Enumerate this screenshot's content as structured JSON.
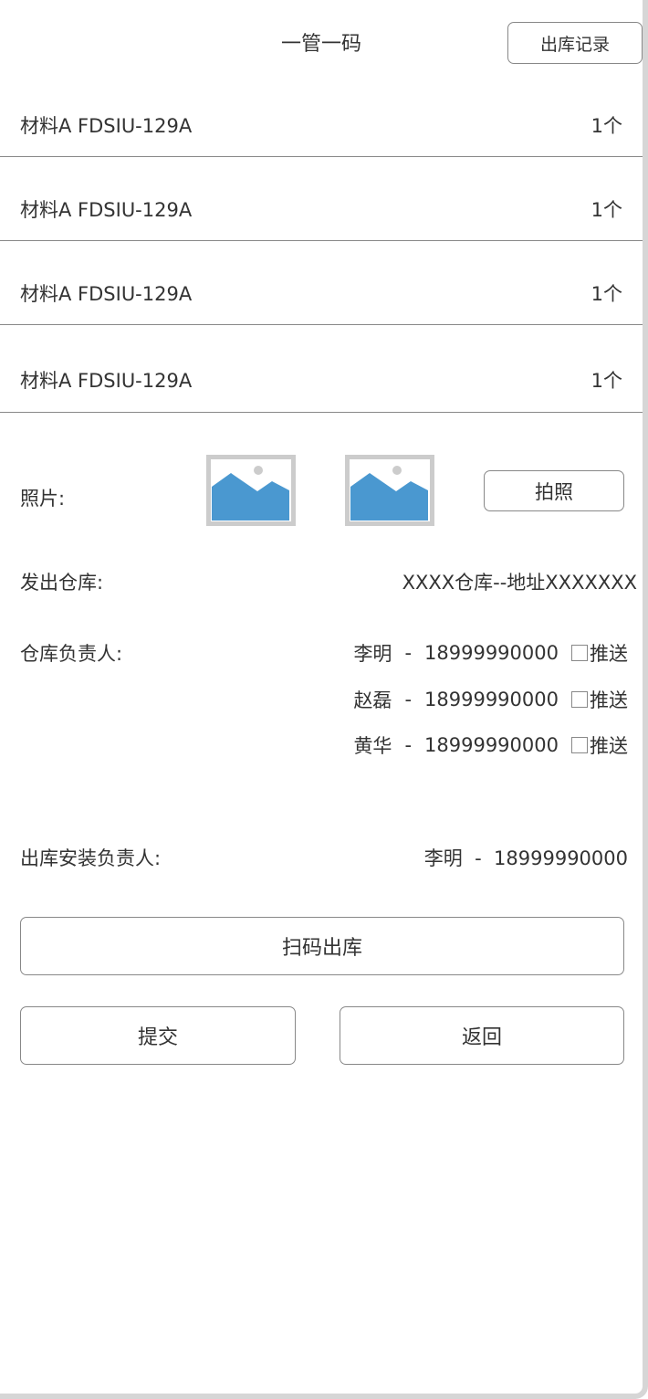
{
  "header": {
    "title": "一管一码",
    "records_button": "出库记录"
  },
  "materials": [
    {
      "name": "材料A FDSIU-129A",
      "qty": "1个"
    },
    {
      "name": "材料A FDSIU-129A",
      "qty": "1个"
    },
    {
      "name": "材料A FDSIU-129A",
      "qty": "1个"
    },
    {
      "name": "材料A FDSIU-129A",
      "qty": "1个"
    }
  ],
  "photo": {
    "label": "照片:",
    "take_photo_button": "拍照",
    "icon": "image-placeholder-icon",
    "accent": "#4a98d0"
  },
  "warehouse": {
    "label": "发出仓库:",
    "value": "XXXX仓库--地址XXXXXXX"
  },
  "managers": {
    "label": "仓库负责人:",
    "push_label": "推送",
    "items": [
      {
        "name": "李明",
        "sep": "-",
        "phone": "18999990000",
        "push": false
      },
      {
        "name": "赵磊",
        "sep": "-",
        "phone": "18999990000",
        "push": false
      },
      {
        "name": "黄华",
        "sep": "-",
        "phone": "18999990000",
        "push": false
      }
    ]
  },
  "installer": {
    "label": "出库安装负责人:",
    "value": "李明  -  18999990000"
  },
  "actions": {
    "scan": "扫码出库",
    "submit": "提交",
    "back": "返回"
  }
}
